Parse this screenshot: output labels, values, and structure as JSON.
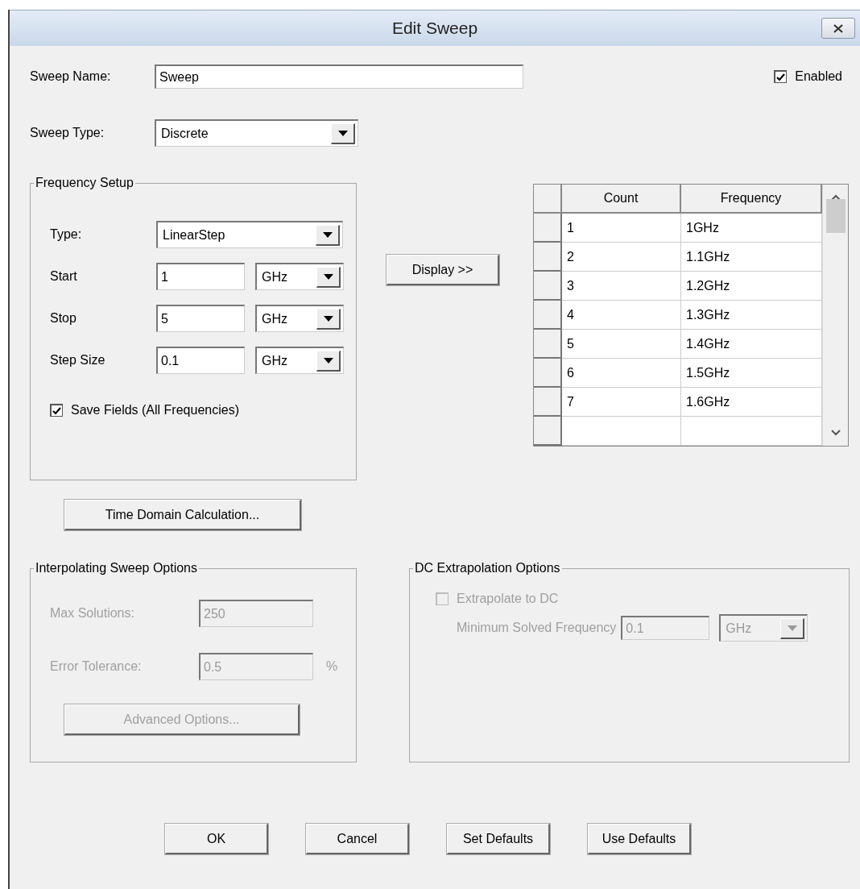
{
  "window": {
    "title": "Edit Sweep"
  },
  "sweep_name": {
    "label": "Sweep Name:",
    "value": "Sweep"
  },
  "enabled": {
    "label": "Enabled",
    "checked": true
  },
  "sweep_type": {
    "label": "Sweep Type:",
    "value": "Discrete"
  },
  "frequency_setup": {
    "title": "Frequency Setup",
    "type": {
      "label": "Type:",
      "value": "LinearStep"
    },
    "fields": [
      {
        "label": "Start",
        "value": "1",
        "unit": "GHz"
      },
      {
        "label": "Stop",
        "value": "5",
        "unit": "GHz"
      },
      {
        "label": "Step Size",
        "value": "0.1",
        "unit": "GHz"
      }
    ],
    "save_fields": {
      "label": "Save Fields (All Frequencies)",
      "checked": true
    }
  },
  "display_button": "Display >>",
  "table": {
    "columns": [
      "Count",
      "Frequency"
    ],
    "rows": [
      [
        "1",
        "1GHz"
      ],
      [
        "2",
        "1.1GHz"
      ],
      [
        "3",
        "1.2GHz"
      ],
      [
        "4",
        "1.3GHz"
      ],
      [
        "5",
        "1.4GHz"
      ],
      [
        "6",
        "1.5GHz"
      ],
      [
        "7",
        "1.6GHz"
      ]
    ]
  },
  "time_domain_button": "Time Domain Calculation...",
  "interpolating": {
    "title": "Interpolating Sweep Options",
    "disabled": true,
    "max_solutions": {
      "label": "Max Solutions:",
      "value": "250"
    },
    "error_tolerance": {
      "label": "Error Tolerance:",
      "value": "0.5",
      "unit": "%"
    },
    "advanced_button": "Advanced Options..."
  },
  "dc_extrapolation": {
    "title": "DC Extrapolation Options",
    "disabled": true,
    "extrapolate": {
      "label": "Extrapolate to DC",
      "checked": false
    },
    "min_frequency": {
      "label": "Minimum Solved Frequency",
      "value": "0.1",
      "unit": "GHz"
    }
  },
  "buttons": [
    "OK",
    "Cancel",
    "Set Defaults",
    "Use Defaults"
  ]
}
